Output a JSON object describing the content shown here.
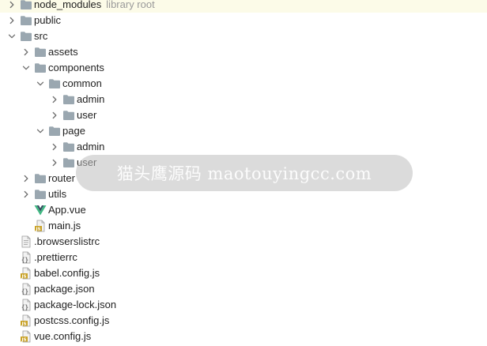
{
  "tree": [
    {
      "label": "node_modules",
      "hint": "library root",
      "type": "folder",
      "depth": 0,
      "expand": "collapsed",
      "highlight": true
    },
    {
      "label": "public",
      "type": "folder",
      "depth": 0,
      "expand": "collapsed"
    },
    {
      "label": "src",
      "type": "folder",
      "depth": 0,
      "expand": "expanded"
    },
    {
      "label": "assets",
      "type": "folder",
      "depth": 1,
      "expand": "collapsed"
    },
    {
      "label": "components",
      "type": "folder",
      "depth": 1,
      "expand": "expanded"
    },
    {
      "label": "common",
      "type": "folder",
      "depth": 2,
      "expand": "expanded"
    },
    {
      "label": "admin",
      "type": "folder",
      "depth": 3,
      "expand": "collapsed"
    },
    {
      "label": "user",
      "type": "folder",
      "depth": 3,
      "expand": "collapsed"
    },
    {
      "label": "page",
      "type": "folder",
      "depth": 2,
      "expand": "expanded"
    },
    {
      "label": "admin",
      "type": "folder",
      "depth": 3,
      "expand": "collapsed"
    },
    {
      "label": "user",
      "type": "folder",
      "depth": 3,
      "expand": "collapsed"
    },
    {
      "label": "router",
      "type": "folder",
      "depth": 1,
      "expand": "collapsed"
    },
    {
      "label": "utils",
      "type": "folder",
      "depth": 1,
      "expand": "collapsed"
    },
    {
      "label": "App.vue",
      "type": "vue",
      "depth": 1,
      "expand": "none"
    },
    {
      "label": "main.js",
      "type": "js",
      "depth": 1,
      "expand": "none"
    },
    {
      "label": ".browserslistrc",
      "type": "text",
      "depth": 0,
      "expand": "none"
    },
    {
      "label": ".prettierrc",
      "type": "config",
      "depth": 0,
      "expand": "none"
    },
    {
      "label": "babel.config.js",
      "type": "js",
      "depth": 0,
      "expand": "none"
    },
    {
      "label": "package.json",
      "type": "config",
      "depth": 0,
      "expand": "none"
    },
    {
      "label": "package-lock.json",
      "type": "config",
      "depth": 0,
      "expand": "none"
    },
    {
      "label": "postcss.config.js",
      "type": "js",
      "depth": 0,
      "expand": "none"
    },
    {
      "label": "vue.config.js",
      "type": "js",
      "depth": 0,
      "expand": "none"
    }
  ],
  "watermark": "猫头鹰源码 maotouyingcc.com",
  "colors": {
    "folder": "#9aa7b0",
    "chevron": "#6e6e6e",
    "vue_green": "#41b883",
    "vue_dark": "#35495e",
    "js_badge": "#c9a227",
    "highlight_row": "#fcfbe8"
  }
}
